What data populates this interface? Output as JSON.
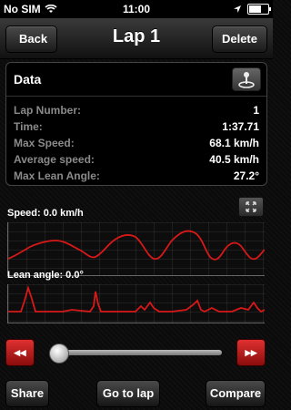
{
  "status_bar": {
    "carrier": "No SIM",
    "time": "11:00",
    "battery_level": 0.7
  },
  "nav": {
    "back_label": "Back",
    "title": "Lap 1",
    "delete_label": "Delete"
  },
  "data_panel": {
    "header": "Data",
    "rows": [
      {
        "label": "Lap Number:",
        "value": "1"
      },
      {
        "label": "Time:",
        "value": "1:37.71"
      },
      {
        "label": "Max Speed:",
        "value": "68.1 km/h"
      },
      {
        "label": "Average speed:",
        "value": "40.5 km/h"
      },
      {
        "label": "Max Lean Angle:",
        "value": "27.2°"
      }
    ]
  },
  "graphs": {
    "speed_label": "Speed: 0.0 km/h",
    "lean_label": "Lean angle: 0.0°"
  },
  "playback": {
    "rewind_symbol": "◂◂",
    "forward_symbol": "▸▸",
    "position": 0
  },
  "bottom": {
    "share_label": "Share",
    "goto_label": "Go to lap",
    "compare_label": "Compare"
  },
  "colors": {
    "accent": "#d01a1a",
    "graph_line": "#e01818"
  }
}
